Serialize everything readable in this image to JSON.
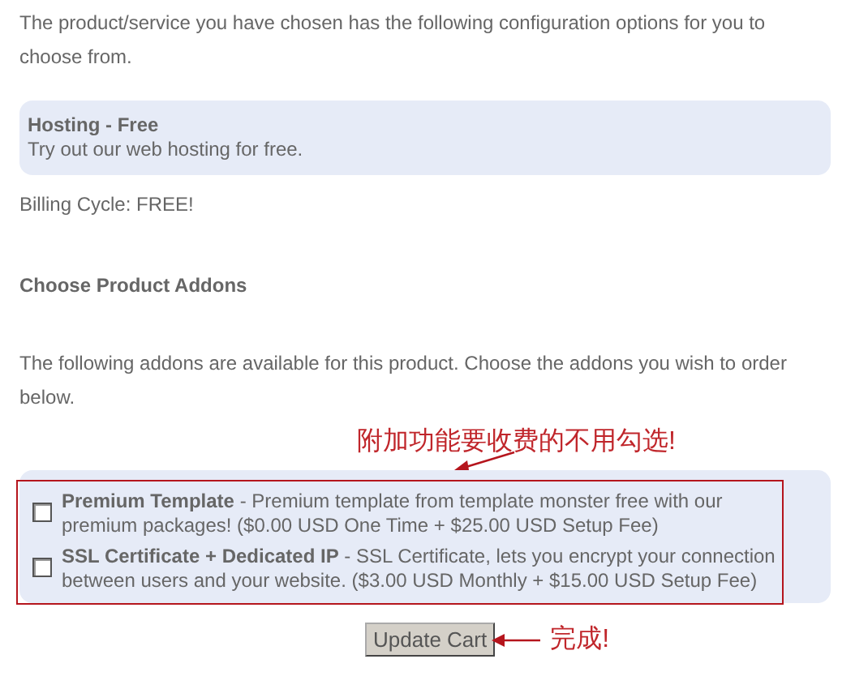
{
  "intro": "The product/service you have chosen has the following configuration options for you to choose from.",
  "option": {
    "title": "Hosting - Free",
    "description": "Try out our web hosting for free."
  },
  "billing_cycle": "Billing Cycle: FREE!",
  "addons_heading": "Choose Product Addons",
  "addons_intro": "The following addons are available for this product. Choose the addons you wish to order below.",
  "annotations": [
    {
      "text": "附加功能要收费的不用勾选!"
    },
    {
      "text": "完成!"
    }
  ],
  "addons": [
    {
      "text": "**Premium Template** - Premium template from template monster free with our premium packages! ($0.00 USD One Time + $25.00 USD Setup Fee)",
      "checked": false
    },
    {
      "text": "**SSL Certificate + Dedicated IP** - SSL Certificate, lets you encrypt your connection between users and your website. ($3.00 USD Monthly + $15.00 USD Setup Fee)",
      "checked": false
    }
  ],
  "button": "Update Cart"
}
